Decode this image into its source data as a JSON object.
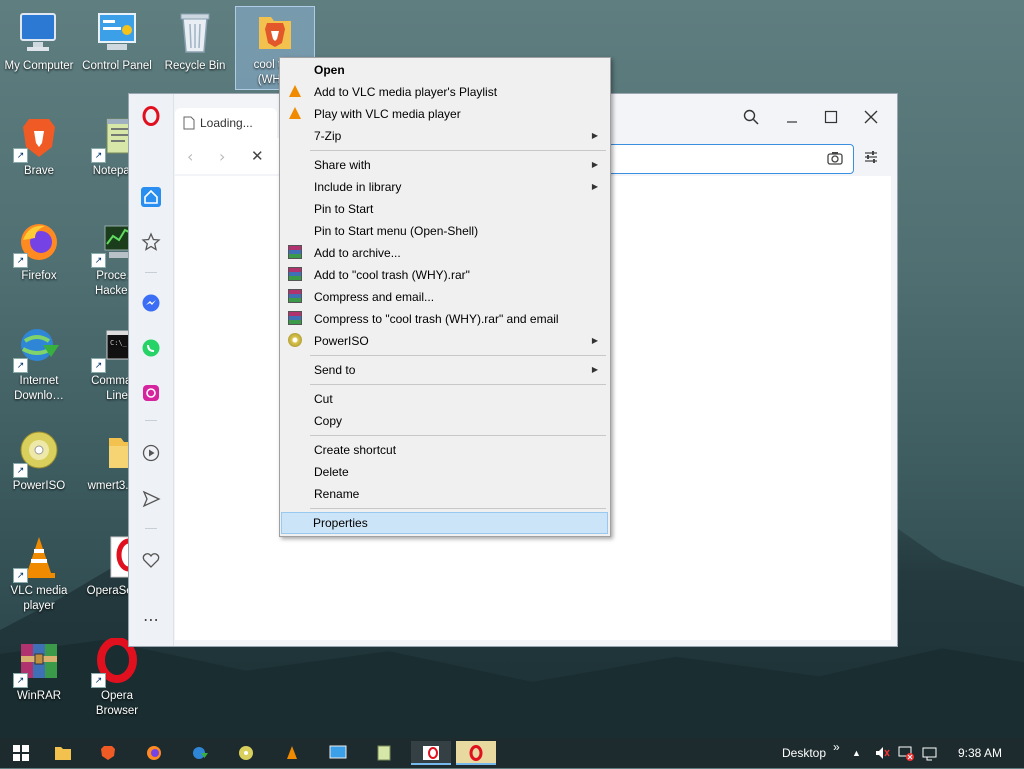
{
  "desktop": {
    "icons": [
      {
        "label": "My Computer",
        "shortcut": false
      },
      {
        "label": "Control Panel",
        "shortcut": false
      },
      {
        "label": "Recycle Bin",
        "shortcut": false
      },
      {
        "label": "cool tr…\n(WH…",
        "shortcut": false,
        "selected": true
      },
      {
        "label": "Brave",
        "shortcut": true
      },
      {
        "label": "Notepa…",
        "shortcut": true
      },
      {
        "label": "Firefox",
        "shortcut": true
      },
      {
        "label": "Proce…\nHacke…",
        "shortcut": true
      },
      {
        "label": "Internet\nDownlo…",
        "shortcut": true
      },
      {
        "label": "Comma…\nLine",
        "shortcut": true
      },
      {
        "label": "PowerISO",
        "shortcut": true
      },
      {
        "label": "wmert3.2…",
        "shortcut": false
      },
      {
        "label": "VLC media\nplayer",
        "shortcut": true
      },
      {
        "label": "OperaSet…",
        "shortcut": false
      },
      {
        "label": "WinRAR",
        "shortcut": true
      },
      {
        "label": "Opera\nBrowser",
        "shortcut": true
      }
    ]
  },
  "browser": {
    "tab_title": "Loading...",
    "address_value": ""
  },
  "context_menu": {
    "items": [
      {
        "label": "Open",
        "icon": "",
        "bold": true,
        "submenu": false
      },
      {
        "label": "Add to VLC media player's Playlist",
        "icon": "vlc-icon",
        "submenu": false
      },
      {
        "label": "Play with VLC media player",
        "icon": "vlc-icon",
        "submenu": false
      },
      {
        "label": "7-Zip",
        "icon": "",
        "submenu": true
      },
      {
        "label": "Share with",
        "icon": "",
        "submenu": true
      },
      {
        "label": "Include in library",
        "icon": "",
        "submenu": true
      },
      {
        "label": "Pin to Start",
        "icon": "",
        "submenu": false
      },
      {
        "label": "Pin to Start menu (Open-Shell)",
        "icon": "",
        "submenu": false
      },
      {
        "label": "Add to archive...",
        "icon": "winrar-icon",
        "submenu": false
      },
      {
        "label": "Add to \"cool trash (WHY).rar\"",
        "icon": "winrar-icon",
        "submenu": false
      },
      {
        "label": "Compress and email...",
        "icon": "winrar-icon",
        "submenu": false
      },
      {
        "label": "Compress to \"cool trash (WHY).rar\" and email",
        "icon": "winrar-icon",
        "submenu": false
      },
      {
        "label": "PowerISO",
        "icon": "poweriso-icon",
        "submenu": true
      },
      {
        "label": "Send to",
        "icon": "",
        "submenu": true
      },
      {
        "label": "Cut",
        "icon": "",
        "submenu": false
      },
      {
        "label": "Copy",
        "icon": "",
        "submenu": false
      },
      {
        "label": "Create shortcut",
        "icon": "",
        "submenu": false
      },
      {
        "label": "Delete",
        "icon": "",
        "submenu": false
      },
      {
        "label": "Rename",
        "icon": "",
        "submenu": false
      },
      {
        "label": "Properties",
        "icon": "",
        "submenu": false,
        "highlighted": true
      }
    ]
  },
  "taskbar": {
    "desktop_label": "Desktop",
    "chevron": "»",
    "time": "9:38 AM"
  },
  "colors": {
    "accent": "#3b8fe0",
    "opera_red": "#e0101f",
    "menu_highlight": "#cce4f7"
  }
}
